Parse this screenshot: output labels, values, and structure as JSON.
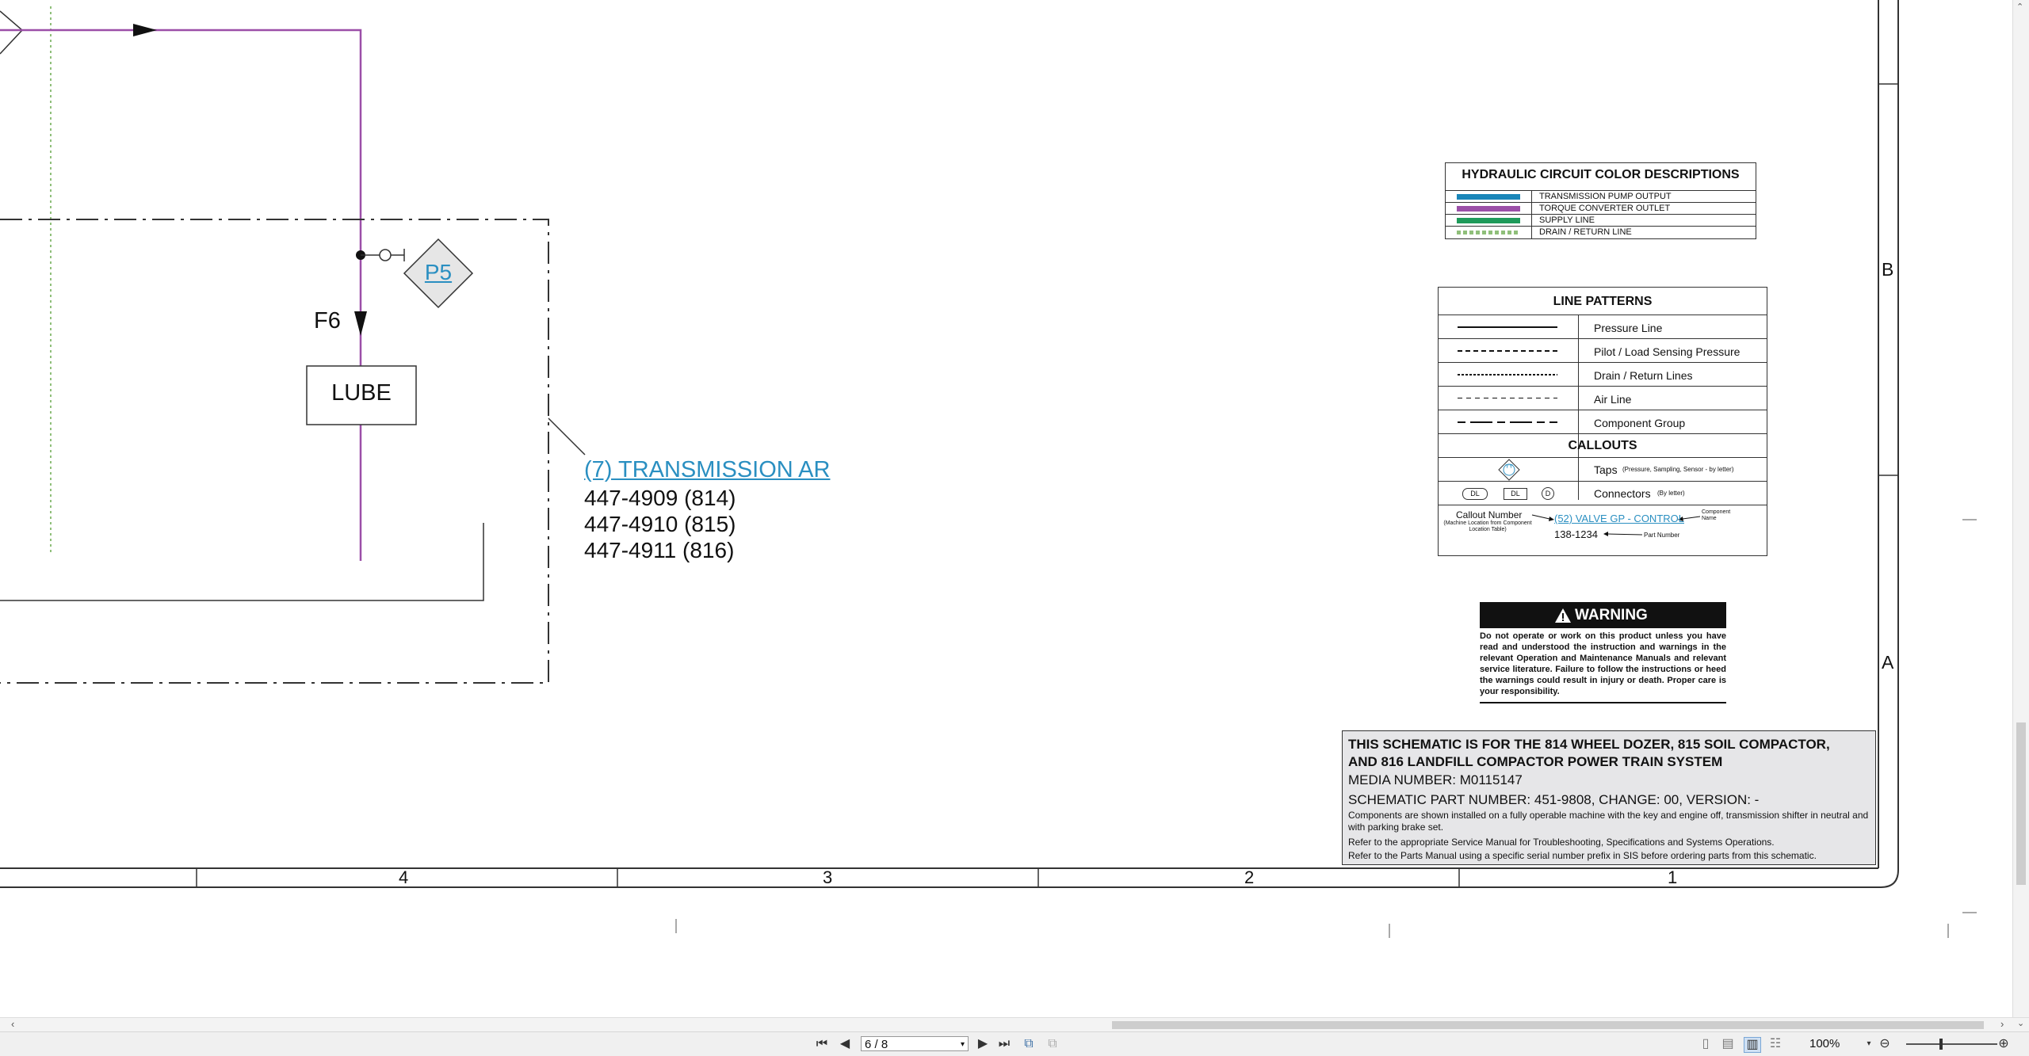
{
  "diagram": {
    "f6_label": "F6",
    "lube_label": "LUBE",
    "p5_label": "P5",
    "transmission": {
      "link": "(7) TRANSMISSION AR",
      "parts": [
        "447-4909 (814)",
        "447-4910 (815)",
        "447-4911 (816)"
      ]
    },
    "border_numbers": [
      "4",
      "3",
      "2",
      "1"
    ],
    "border_letters": [
      "B",
      "A"
    ]
  },
  "colors": {
    "transmission_pump_output": "#1a86b9",
    "torque_converter_outlet": "#9b4fa8",
    "supply_line": "#1e9a5a",
    "drain_return_line": "#8fbf7a",
    "link": "#2a8fc1"
  },
  "color_legend": {
    "title": "HYDRAULIC CIRCUIT COLOR DESCRIPTIONS",
    "items": [
      "TRANSMISSION PUMP OUTPUT",
      "TORQUE CONVERTER OUTLET",
      "SUPPLY LINE",
      "DRAIN / RETURN LINE"
    ]
  },
  "line_patterns": {
    "title": "LINE PATTERNS",
    "items": [
      "Pressure Line",
      "Pilot / Load Sensing Pressure",
      "Drain / Return Lines",
      "Air Line",
      "Component Group"
    ],
    "callouts_title": "CALLOUTS",
    "taps_label": "Taps",
    "taps_note": "(Pressure, Sampling, Sensor - by letter)",
    "tap_symbol": "YY",
    "connectors_label": "Connectors",
    "connectors_note": "(By letter)",
    "connector_symbols": [
      "DL",
      "DL",
      "D"
    ],
    "callout_number": "Callout Number",
    "callout_note": "(Machine Location from Component Location Table)",
    "example_link": "(52) VALVE GP - CONTROL",
    "component_name": "Component Name",
    "example_part": "138-1234",
    "part_number_label": "Part Number"
  },
  "warning": {
    "title": "WARNING",
    "text": "Do not operate or work on this product unless you have read and understood the instruction and warnings in the relevant Operation and Maintenance Manuals and relevant service literature. Failure to follow the instructions or heed the warnings could result in injury or death. Proper care is your responsibility."
  },
  "title_block": {
    "line1": "THIS SCHEMATIC IS FOR THE 814 WHEEL DOZER, 815 SOIL COMPACTOR,",
    "line2": "AND 816 LANDFILL COMPACTOR POWER TRAIN SYSTEM",
    "media": "MEDIA NUMBER: M0115147",
    "part": "SCHEMATIC PART NUMBER: 451-9808, CHANGE: 00, VERSION: -",
    "note1": "Components are shown installed on a fully operable machine with the key and engine off, transmission shifter in neutral and with parking brake set.",
    "note2": "Refer to the appropriate Service Manual for Troubleshooting, Specifications and Systems Operations.",
    "note3": "Refer to the Parts Manual using a specific serial number prefix in SIS before ordering parts from this schematic."
  },
  "statusbar": {
    "page": "6 / 8",
    "zoom": "100%"
  }
}
